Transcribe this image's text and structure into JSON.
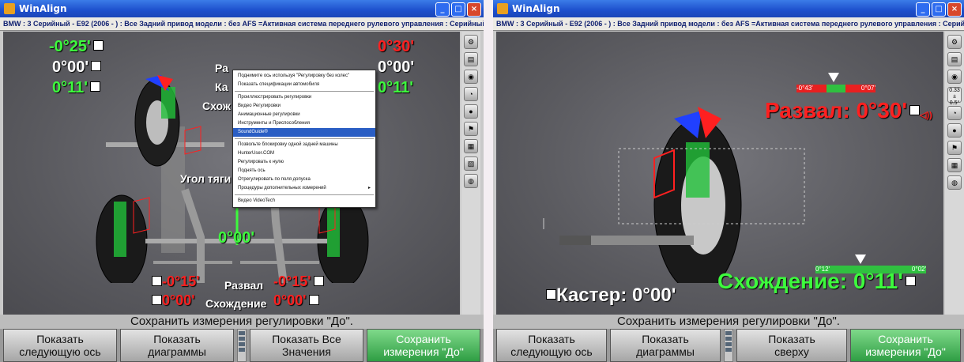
{
  "window_title": "WinAlign",
  "info_bar": "BMW : 3 Серийный - E92 (2006 - ) : Все Задний привод модели : без AFS =Активная система переднего рулевого управления : Серийный : 16\" Колесо",
  "left": {
    "values": {
      "camber_left": "-0°25'",
      "caster_left": "0°00'",
      "toe_left": "0°11'",
      "camber_right": "0°30'",
      "caster_right": "0°00'",
      "toe_right": "0°11'",
      "thrust": "0°00'",
      "rear_camber_left": "-0°15'",
      "rear_toe_left": "0°00'",
      "rear_camber_right": "-0°15'",
      "rear_toe_right": "0°00'"
    },
    "labels": {
      "ra_partial": "Ра",
      "ka_partial": "Ка",
      "skhozh_partial": "Схож",
      "thrust_partial": "Угол тяги",
      "camber": "Развал",
      "toe": "Схождение"
    },
    "context_menu": [
      "Поднимите ось используя \"Регулировку без колес\"",
      "Показать спецификации автомобиля",
      "Проиллюстрировать регулировки",
      "Видео Регулировки",
      "Анимационные регулировки",
      "Инструменты и Приспособления",
      "SoundGuide®",
      "Позвольте блокировку одной задней машины",
      "HunterUser.COM",
      "Регулировать к нулю",
      "Поднять ось",
      "Отрегулировать по поля допуска",
      "Процедуры дополнительных измерений",
      "Видео VideoTech"
    ],
    "context_menu_selected": 6,
    "status": "Сохранить измерения регулировки \"До\".",
    "buttons": [
      {
        "line1": "Показать",
        "line2": "следующую ось"
      },
      {
        "line1": "Показать",
        "line2": "диаграммы"
      },
      {
        "line1": "Показать Все",
        "line2": "Значения"
      },
      {
        "line1": "Сохранить",
        "line2": "измерения \"До\""
      }
    ]
  },
  "right": {
    "camber_big": "Развал: 0°30'",
    "camber_band_left": "-0°43'",
    "camber_band_right": "0°07'",
    "toe_band_left": "0°12'",
    "toe_band_right": "0°02'",
    "toe_big": "Схождение: 0°11'",
    "caster_big": "Кастер: 0°00'",
    "side_values": "0.33\n± 0.5°",
    "status": "Сохранить измерения регулировки \"До\".",
    "buttons": [
      {
        "line1": "Показать",
        "line2": "следующую ось"
      },
      {
        "line1": "Показать",
        "line2": "диаграммы"
      },
      {
        "line1": "Показать",
        "line2": "сверху"
      },
      {
        "line1": "Сохранить",
        "line2": "измерения \"До\""
      }
    ]
  },
  "colors": {
    "ok": "#3dfa3d",
    "out": "#ff2020",
    "accent": "#2f9e44"
  }
}
